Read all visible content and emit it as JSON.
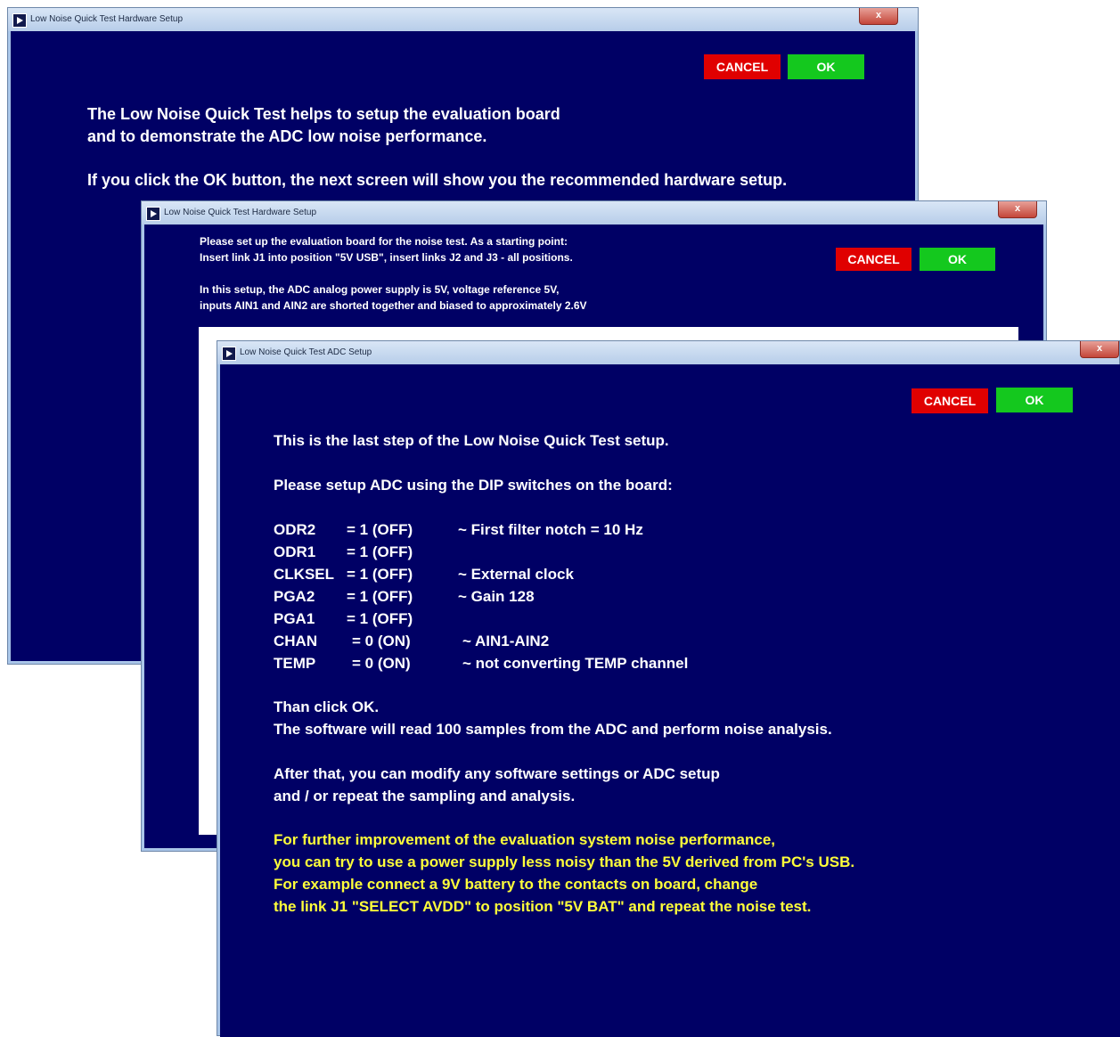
{
  "colors": {
    "client_bg": "#000065",
    "cancel": "#e00000",
    "ok": "#14c81e",
    "note": "#ffff3a"
  },
  "window1": {
    "title": "Low Noise Quick Test Hardware Setup",
    "close_label": "x",
    "cancel_label": "CANCEL",
    "ok_label": "OK",
    "lines": [
      "The Low Noise Quick Test helps to setup the evaluation board",
      "and to demonstrate the ADC low noise performance.",
      "If you click the OK button, the next screen will show you the recommended hardware setup."
    ]
  },
  "window2": {
    "title": "Low Noise Quick Test Hardware Setup",
    "close_label": "x",
    "cancel_label": "CANCEL",
    "ok_label": "OK",
    "lines": [
      "Please set up the evaluation board for the noise test. As a starting point:",
      "Insert link J1 into position \"5V USB\", insert links J2 and J3 - all positions.",
      "In this setup, the ADC analog power supply is 5V, voltage reference 5V,",
      "inputs AIN1 and AIN2 are shorted together and biased to approximately 2.6V"
    ]
  },
  "window3": {
    "title": "Low Noise Quick Test ADC Setup",
    "close_label": "x",
    "cancel_label": "CANCEL",
    "ok_label": "OK",
    "intro": [
      "This is the last step of the Low Noise Quick Test setup.",
      "Please setup ADC using the DIP switches on the board:"
    ],
    "switches": [
      {
        "name": "ODR2",
        "value": "= 1 (OFF)",
        "note": "~ First filter notch = 10 Hz"
      },
      {
        "name": "ODR1",
        "value": "= 1 (OFF)",
        "note": ""
      },
      {
        "name": "CLKSEL",
        "value": "= 1 (OFF)",
        "note": "~ External clock"
      },
      {
        "name": "PGA2",
        "value": "= 1 (OFF)",
        "note": "~ Gain 128"
      },
      {
        "name": "PGA1",
        "value": "= 1 (OFF)",
        "note": ""
      },
      {
        "name": "CHAN",
        "value": "= 0 (ON)",
        "note": "~ AIN1-AIN2"
      },
      {
        "name": "TEMP",
        "value": "= 0 (ON)",
        "note": "~ not converting TEMP channel"
      }
    ],
    "after": [
      "Than click OK.",
      "The software will read 100 samples from the ADC and perform noise analysis.",
      "After that, you can modify any software settings or ADC setup",
      "and / or repeat the sampling and analysis."
    ],
    "yellow": [
      "For further improvement of the evaluation system noise performance,",
      "you can try to use a power supply less noisy than the 5V derived from PC's USB.",
      "For example connect a 9V battery to the contacts on board, change",
      "the link J1 \"SELECT AVDD\" to position \"5V BAT\" and repeat the noise test."
    ]
  }
}
